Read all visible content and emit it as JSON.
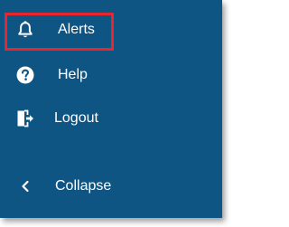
{
  "nav": {
    "items": [
      {
        "id": "alerts",
        "label": "Alerts",
        "icon": "bell-icon"
      },
      {
        "id": "help",
        "label": "Help",
        "icon": "question-circle-icon"
      },
      {
        "id": "logout",
        "label": "Logout",
        "icon": "logout-icon"
      },
      {
        "id": "collapse",
        "label": "Collapse",
        "icon": "chevron-left-icon"
      }
    ]
  },
  "colors": {
    "panel_background": "#0f5584",
    "text": "#ffffff",
    "highlight_border": "#e8262d"
  }
}
